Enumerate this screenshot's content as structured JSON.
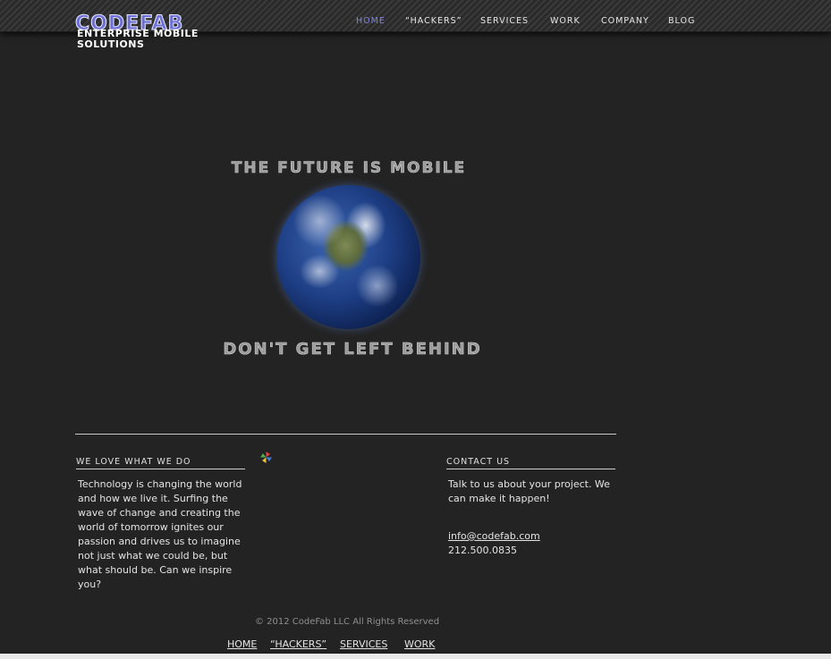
{
  "header": {
    "logo_main": "CODEFAB",
    "logo_sub_line1": "ENTERPRISE MOBILE",
    "logo_sub_line2": "SOLUTIONS",
    "nav": [
      "HOME",
      "“HACKERS”",
      "SERVICES",
      "WORK",
      "COMPANY",
      "BLOG"
    ],
    "active_nav": "HOME",
    "active_color": "#7f86e0"
  },
  "hero": {
    "top_text": "THE FUTURE IS MOBILE",
    "bottom_text": "DON'T GET LEFT BEHIND",
    "image": "earth-globe"
  },
  "about": {
    "title": "WE LOVE WHAT WE DO",
    "text": "Technology is changing the world and how we live it. Surfing the wave of change and creating the world of tomorrow ignites our passion and drives us to imagine not just what we could be, but what should be. Can we inspire you?"
  },
  "contact": {
    "title": "CONTACT US",
    "text": "Talk to us about your project. We can make it happen!",
    "email": "info@codefab.com",
    "phone": "212.500.0835"
  },
  "footer": {
    "copyright": "© 2012 CodeFab LLC All Rights Reserved",
    "nav": [
      "HOME",
      "“HACKERS”",
      "SERVICES",
      "WORK"
    ]
  }
}
